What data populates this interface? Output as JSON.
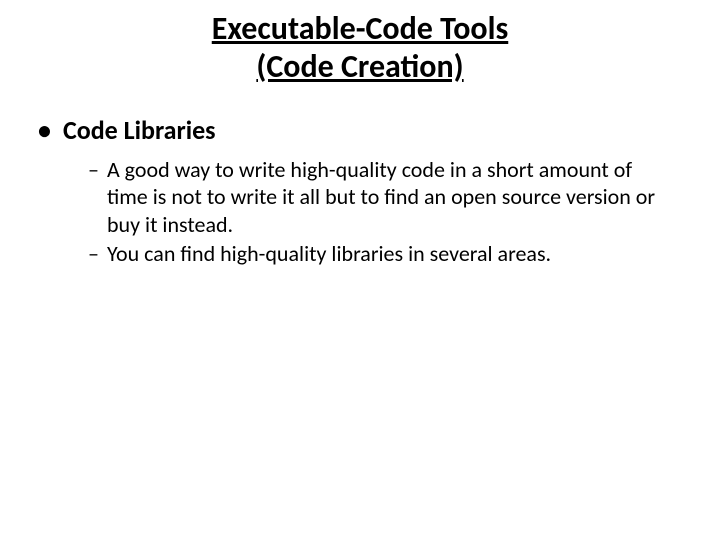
{
  "title_line1": "Executable-Code Tools",
  "title_line2": "(Code Creation)",
  "bullet_symbol": "•",
  "dash_symbol": "–",
  "level1_text": "Code Libraries",
  "level2_items": [
    "A good way to write high-quality code in a short amount of time is not to write it all but to find an open source version or buy it instead.",
    "You can find high-quality libraries in several areas."
  ]
}
